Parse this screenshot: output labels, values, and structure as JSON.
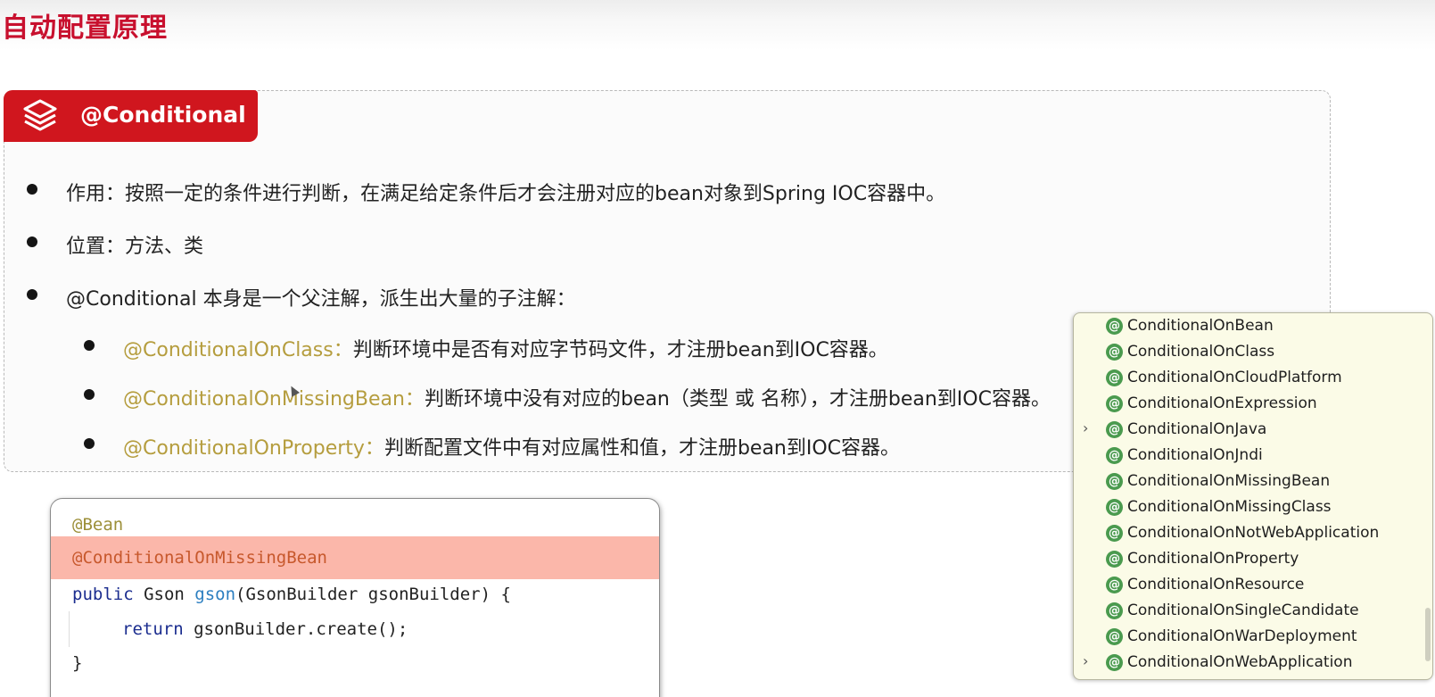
{
  "page": {
    "title": "自动配置原理"
  },
  "card": {
    "tag_label": "@Conditional",
    "tag_icon": "layers-icon",
    "accent_color": "#d0161e",
    "bullets": [
      {
        "text": "作用：按照一定的条件进行判断，在满足给定条件后才会注册对应的bean对象到Spring IOC容器中。"
      },
      {
        "text": "位置：方法、类"
      },
      {
        "text": "@Conditional 本身是一个父注解，派生出大量的子注解："
      }
    ],
    "sub_bullets": [
      {
        "key": "@ConditionalOnClass：",
        "desc": "判断环境中是否有对应字节码文件，才注册bean到IOC容器。"
      },
      {
        "key": "@ConditionalOnMissingBean：",
        "desc": "判断环境中没有对应的bean（类型 或 名称），才注册bean到IOC容器。"
      },
      {
        "key": "@ConditionalOnProperty：",
        "desc": "判断配置文件中有对应属性和值，才注册bean到IOC容器。"
      }
    ]
  },
  "code": {
    "line1": "@Bean",
    "line2": "@ConditionalOnMissingBean",
    "line3_kw": "public",
    "line3_type": " Gson ",
    "line3_fn": "gson",
    "line3_rest": "(GsonBuilder gsonBuilder) {",
    "line4_kw": "return",
    "line4_rest": " gsonBuilder.create();",
    "line5": "}"
  },
  "popup": {
    "icon": "annotation-icon",
    "icon_color": "#4a9a4e",
    "items": [
      {
        "label": "ConditionalOnBean",
        "expandable": false
      },
      {
        "label": "ConditionalOnClass",
        "expandable": false
      },
      {
        "label": "ConditionalOnCloudPlatform",
        "expandable": false
      },
      {
        "label": "ConditionalOnExpression",
        "expandable": false
      },
      {
        "label": "ConditionalOnJava",
        "expandable": true
      },
      {
        "label": "ConditionalOnJndi",
        "expandable": false
      },
      {
        "label": "ConditionalOnMissingBean",
        "expandable": false
      },
      {
        "label": "ConditionalOnMissingClass",
        "expandable": false
      },
      {
        "label": "ConditionalOnNotWebApplication",
        "expandable": false
      },
      {
        "label": "ConditionalOnProperty",
        "expandable": false
      },
      {
        "label": "ConditionalOnResource",
        "expandable": false
      },
      {
        "label": "ConditionalOnSingleCandidate",
        "expandable": false
      },
      {
        "label": "ConditionalOnWarDeployment",
        "expandable": false
      },
      {
        "label": "ConditionalOnWebApplication",
        "expandable": true
      }
    ]
  }
}
